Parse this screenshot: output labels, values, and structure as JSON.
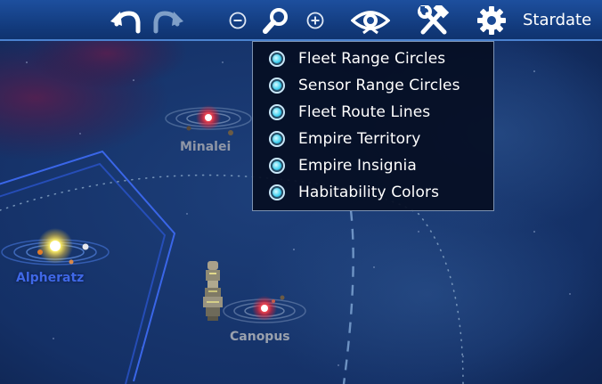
{
  "toolbar": {
    "buttons": [
      {
        "id": "undo",
        "icon": "undo-arrow-icon"
      },
      {
        "id": "redo",
        "icon": "redo-arrow-icon",
        "disabled": true
      },
      {
        "id": "zoom-out",
        "icon": "zoom-out-icon"
      },
      {
        "id": "zoom",
        "icon": "magnifier-icon"
      },
      {
        "id": "zoom-in",
        "icon": "zoom-in-icon"
      },
      {
        "id": "view",
        "icon": "eye-icon"
      },
      {
        "id": "tools",
        "icon": "hammer-wrench-icon"
      },
      {
        "id": "settings",
        "icon": "gear-icon"
      }
    ],
    "stardate_label": "Stardate"
  },
  "view_menu": {
    "items": [
      {
        "label": "Fleet Range Circles",
        "checked": true
      },
      {
        "label": "Sensor Range Circles",
        "checked": true
      },
      {
        "label": "Fleet Route Lines",
        "checked": true
      },
      {
        "label": "Empire Territory",
        "checked": true
      },
      {
        "label": "Empire Insignia",
        "checked": true
      },
      {
        "label": "Habitability Colors",
        "checked": true
      }
    ]
  },
  "map": {
    "systems": [
      {
        "name": "Minalei",
        "star_color": "#ff2a35",
        "label_color": "#8f96a6"
      },
      {
        "name": "Alpheratz",
        "star_color": "#fff45a",
        "label_color": "#3f68e6"
      },
      {
        "name": "Canopus",
        "star_color": "#ff2a35",
        "label_color": "#9aa1ad"
      }
    ],
    "fleet": {
      "icon": "starship-icon"
    }
  },
  "colors": {
    "toolbar": "#1a4a96",
    "territory_border": "#3a66e8",
    "menu_bg": "#050e22",
    "radio_fill": "#3fd0f0"
  }
}
